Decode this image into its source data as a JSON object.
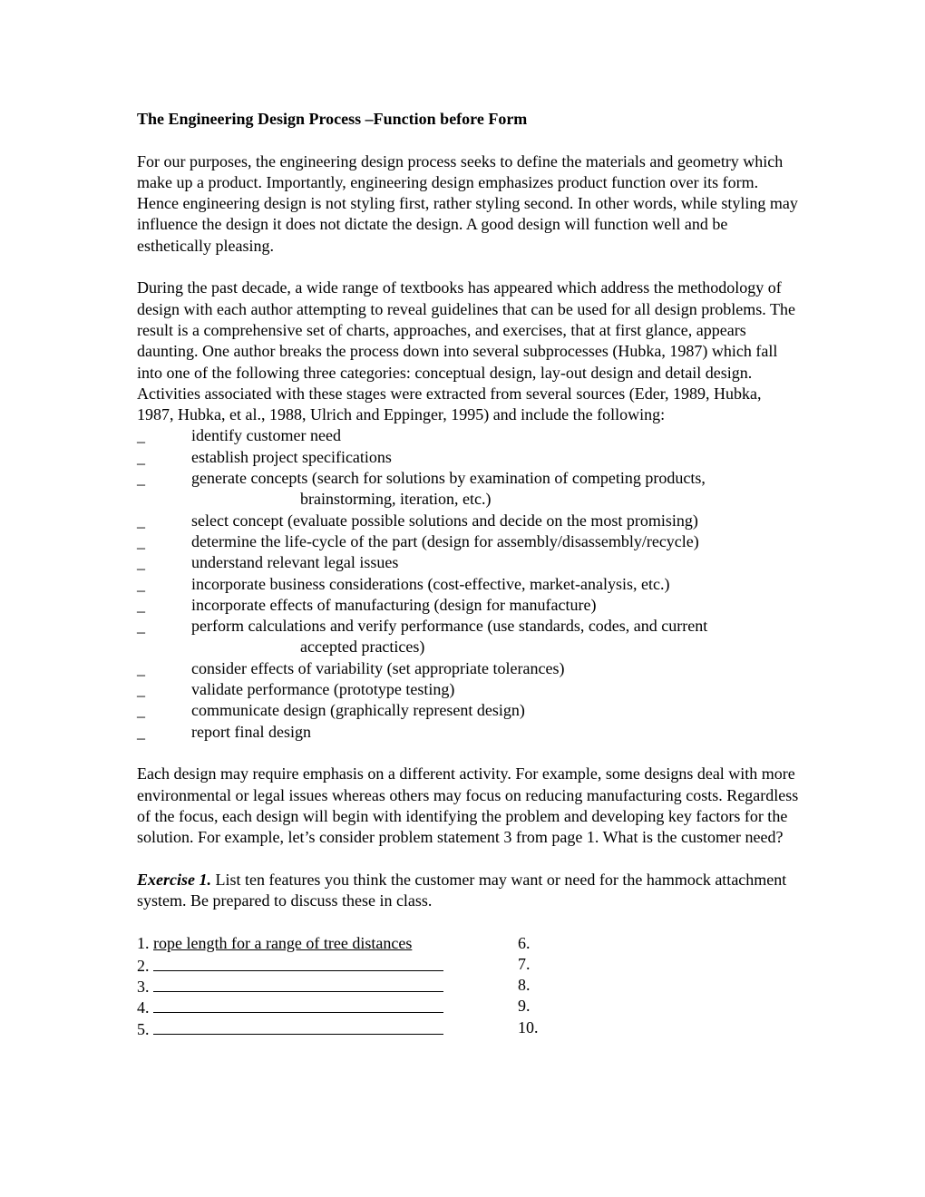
{
  "title": "The Engineering Design Process –Function before Form",
  "paragraph1": "For our purposes, the engineering design process seeks to define the materials and geometry which make up a product. Importantly, engineering design emphasizes product function over its form. Hence engineering design is not styling first, rather styling second. In other words, while styling may influence the design it does not dictate the design. A good design will function well and be esthetically pleasing.",
  "paragraph2": "During the past decade, a wide range of textbooks has appeared which address the methodology of design with each author attempting to reveal guidelines that can be used for all design problems.  The result is a comprehensive set of charts, approaches, and exercises, that at first glance, appears daunting. One author breaks the process down into several subprocesses (Hubka, 1987) which fall into one of the following three categories: conceptual design, lay-out design and detail design.  Activities associated with these stages were extracted from several sources (Eder, 1989, Hubka, 1987, Hubka, et al., 1988, Ulrich and Eppinger, 1995) and include the following:",
  "bullet_glyph": "_",
  "activities": [
    {
      "text": "identify customer need"
    },
    {
      "text": "establish project specifications"
    },
    {
      "text": "generate concepts (search for solutions by examination of competing products,",
      "cont": "brainstorming, iteration, etc.)"
    },
    {
      "text": "select concept (evaluate possible solutions and decide on the most promising)"
    },
    {
      "text": "determine the life-cycle of the part (design for assembly/disassembly/recycle)"
    },
    {
      "text": "understand relevant legal issues"
    },
    {
      "text": "incorporate business considerations (cost-effective, market-analysis, etc.)"
    },
    {
      "text": "incorporate effects of manufacturing (design for manufacture)"
    },
    {
      "text": "perform calculations and verify performance (use standards, codes, and current",
      "cont": "accepted practices)"
    },
    {
      "text": "consider effects of variability (set appropriate tolerances)"
    },
    {
      "text": "validate performance (prototype testing)"
    },
    {
      "text": "communicate design (graphically represent design)"
    },
    {
      "text": "report final design"
    }
  ],
  "paragraph3": "Each design may require emphasis on a different activity. For example, some designs deal with more environmental or legal issues whereas others may focus on reducing manufacturing costs.  Regardless of the focus, each design will begin with identifying the problem and developing key factors for the solution.  For example, let’s consider problem statement 3 from page 1. What is the customer need?",
  "exercise": {
    "label": "Exercise 1.",
    "text": " List ten features you think the customer may want or need for the hammock attachment system. Be prepared to discuss these in class."
  },
  "answers": [
    {
      "left_num": "1.",
      "left_value": "rope length for a range of tree distances",
      "right_num": "6."
    },
    {
      "left_num": "2.",
      "left_value": "",
      "right_num": "7."
    },
    {
      "left_num": "3.",
      "left_value": "",
      "right_num": "8."
    },
    {
      "left_num": "4.",
      "left_value": "",
      "right_num": "9."
    },
    {
      "left_num": "5.",
      "left_value": "",
      "right_num": "10."
    }
  ]
}
